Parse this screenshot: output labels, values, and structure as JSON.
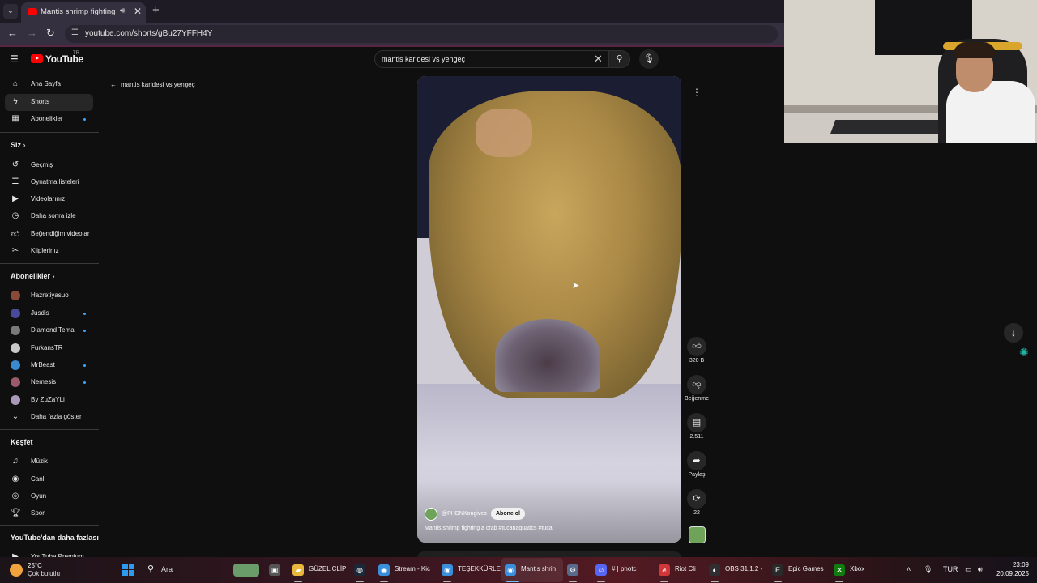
{
  "browser": {
    "tab_title": "Mantis shrimp fighting a crab #tuca",
    "url": "youtube.com/shorts/gBu27YFFH4Y"
  },
  "youtube": {
    "logo_text": "YouTube",
    "logo_country": "TR",
    "search": {
      "query": "mantis karidesi vs yengeç"
    },
    "back_link_label": "mantis karidesi vs yengeç",
    "sidebar": {
      "main": [
        {
          "label": "Ana Sayfa",
          "icon": "home-icon"
        },
        {
          "label": "Shorts",
          "icon": "shorts-icon",
          "active": true
        },
        {
          "label": "Abonelikler",
          "icon": "subscriptions-icon",
          "dot": true
        }
      ],
      "you_heading": "Siz",
      "you_items": [
        {
          "label": "Geçmiş",
          "icon": "history-icon"
        },
        {
          "label": "Oynatma listeleri",
          "icon": "playlists-icon"
        },
        {
          "label": "Videolarınız",
          "icon": "your-videos-icon"
        },
        {
          "label": "Daha sonra izle",
          "icon": "watch-later-icon"
        },
        {
          "label": "Beğendiğim videolar",
          "icon": "liked-videos-icon"
        },
        {
          "label": "Kliplerinız",
          "icon": "clips-icon"
        }
      ],
      "subs_heading": "Abonelikler",
      "subscriptions": [
        {
          "label": "Hazretiyasuo",
          "color": "#8a4a3a"
        },
        {
          "label": "Jusdis",
          "color": "#4a4a9a",
          "dot": true
        },
        {
          "label": "Diamond Tema",
          "color": "#7a7a7a",
          "dot": true
        },
        {
          "label": "FurkansTR",
          "color": "#c8c8c8"
        },
        {
          "label": "MrBeast",
          "color": "#3a8ad0",
          "dot": true
        },
        {
          "label": "Nemesis",
          "color": "#9a5a6a",
          "dot": true
        },
        {
          "label": "By ZuZaYLi",
          "color": "#aa9aba"
        }
      ],
      "show_more": "Daha fazla göster",
      "explore_heading": "Keşfet",
      "explore": [
        {
          "label": "Müzik",
          "icon": "music-icon"
        },
        {
          "label": "Canlı",
          "icon": "live-icon"
        },
        {
          "label": "Oyun",
          "icon": "gaming-icon"
        },
        {
          "label": "Spor",
          "icon": "sports-icon"
        }
      ],
      "more_heading": "YouTube'dan daha fazlası",
      "more": [
        {
          "label": "YouTube Premium",
          "icon": "youtube-premium-icon"
        }
      ]
    },
    "short": {
      "channel": "@PHDNKongives",
      "subscribe_label": "Abone ol",
      "caption": "Mantis shrimp fighting a crab #tucanaquatics #tuca"
    },
    "actions": {
      "likes": "320 B",
      "dislike_label": "Beğenme",
      "comments": "2.511",
      "share_label": "Paylaş",
      "remix_count": "22"
    }
  },
  "taskbar": {
    "weather_temp": "25°C",
    "weather_desc": "Çok bulutlu",
    "search_label": "Ara",
    "apps": [
      {
        "label": "GÜZEL CLİP",
        "icon": "folder-icon",
        "color": "#e8b73c"
      },
      {
        "label": "",
        "icon": "steam-icon",
        "color": "#1b2838"
      },
      {
        "label": "Stream - Kic",
        "icon": "chrome-icon",
        "color": "#3a8fdc"
      },
      {
        "label": "TEŞEKKÜRLE",
        "icon": "chrome-icon",
        "color": "#3a8fdc"
      },
      {
        "label": "Mantis shrin",
        "icon": "chrome-icon",
        "color": "#3a8fdc"
      },
      {
        "label": "",
        "icon": "settings-app-icon",
        "color": "#5a6a8a"
      },
      {
        "label": "# | photc",
        "icon": "discord-icon",
        "color": "#5865f2"
      },
      {
        "label": "Riot Cli",
        "icon": "riot-icon",
        "color": "#d13639"
      },
      {
        "label": "OBS 31.1.2 -",
        "icon": "obs-icon",
        "color": "#302e31"
      },
      {
        "label": "Epic Games",
        "icon": "epic-games-icon",
        "color": "#2a2a2a"
      },
      {
        "label": "Xbox",
        "icon": "xbox-icon",
        "color": "#107c10"
      }
    ],
    "language": "TUR",
    "time": "23:09",
    "date": "20.09.2025"
  }
}
